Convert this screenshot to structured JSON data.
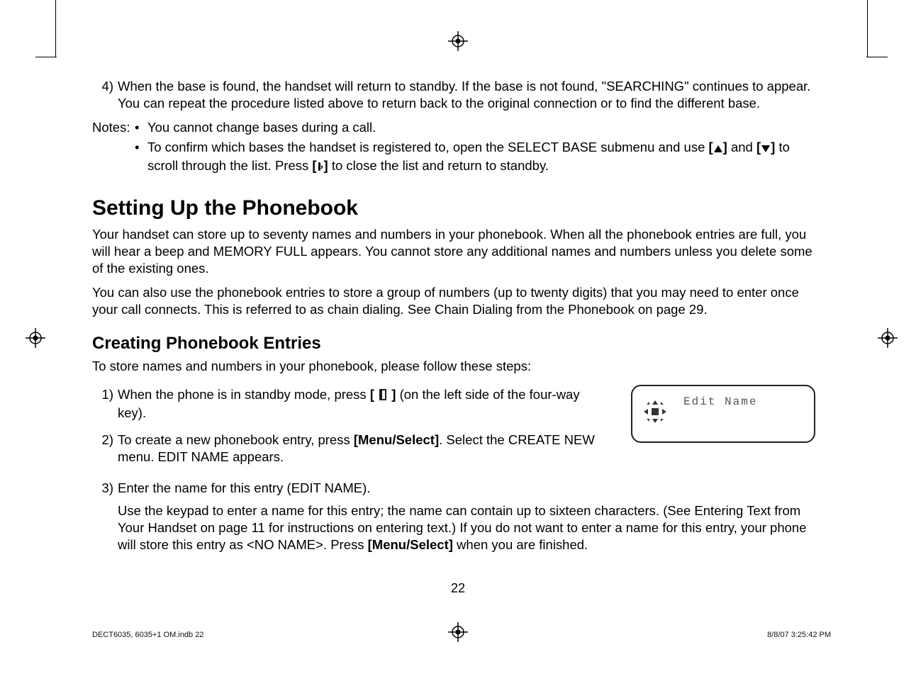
{
  "step4": {
    "num": "4)",
    "text": "When the base is found, the handset will return to standby. If the base is not found, \"SEARCHING\" continues to appear. You can repeat the procedure listed above to return back to the original connection or to find the different base."
  },
  "notes_label": "Notes:",
  "note1": "You cannot change bases during a call.",
  "note2_a": "To confirm which bases the handset is registered to, open the SELECT BASE submenu and use ",
  "note2_b": " and ",
  "note2_c": " to scroll through the list. Press ",
  "note2_d": " to close the list and return to standby.",
  "h1": "Setting Up the Phonebook",
  "p1": "Your handset can store up to seventy names and numbers in your phonebook. When all the phonebook entries are full, you will hear a beep and MEMORY FULL appears. You cannot store any additional names and numbers unless you delete some of the existing ones.",
  "p2": "You can also use the phonebook entries to store a group of numbers (up to twenty digits) that you may need to enter once your call connects. This is referred to as chain dialing. See Chain Dialing from the Phonebook on page 29.",
  "h2": "Creating Phonebook Entries",
  "p3": "To store names and numbers in your phonebook, please follow these steps:",
  "s1": {
    "num": "1)",
    "a": "When the phone is in standby mode, press ",
    "key": "[",
    "key_close": " ]",
    "b": " (on the left side of the four-way key)."
  },
  "s2": {
    "num": "2)",
    "a": "To create a new phonebook entry, press ",
    "key": "[Menu/Select]",
    "b": ". Select the CREATE NEW menu. EDIT NAME appears."
  },
  "s3": {
    "num": "3)",
    "a": "Enter the name for this entry (EDIT NAME)."
  },
  "s3b": {
    "a": "Use the keypad to enter a name for this entry; the name can contain up to sixteen characters. (See Entering Text from Your Handset on page 11 for instructions on entering text.) If you do not want to enter a name for this entry, your phone will store this entry as <NO NAME>. Press ",
    "key": "[Menu/Select]",
    "b": " when you are finished."
  },
  "screen_label": "Edit Name",
  "page_number": "22",
  "footer_left": "DECT6035, 6035+1 OM.indb   22",
  "footer_right": "8/8/07   3:25:42 PM",
  "bracket_open": "[",
  "bracket_close": "]"
}
